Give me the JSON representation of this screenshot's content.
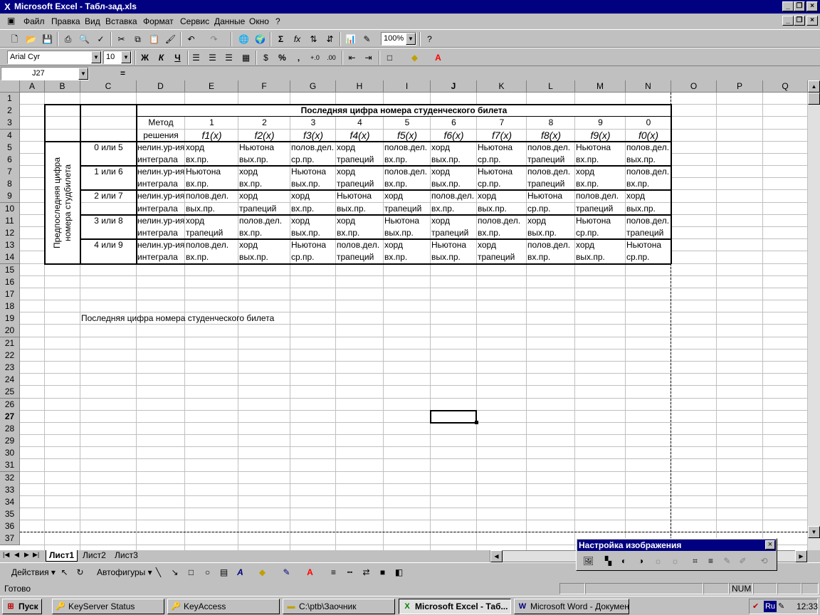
{
  "window": {
    "title": "Microsoft Excel - Табл-зад.xls",
    "app_icon": "excel-icon"
  },
  "menu": [
    "Файл",
    "Правка",
    "Вид",
    "Вставка",
    "Формат",
    "Сервис",
    "Данные",
    "Окно",
    "?"
  ],
  "toolbar": {
    "zoom": "100%",
    "font_name": "Arial Cyr",
    "font_size": "10",
    "bold": "Ж",
    "italic": "К",
    "underline": "Ч",
    "percent": "%",
    "comma": ",",
    "sum": "Σ",
    "fx": "fx"
  },
  "formula": {
    "name_box": "J27",
    "equals": "=",
    "content": ""
  },
  "columns": [
    "A",
    "B",
    "C",
    "D",
    "E",
    "F",
    "G",
    "H",
    "I",
    "J",
    "K",
    "L",
    "M",
    "N",
    "O",
    "P",
    "Q"
  ],
  "rows": [
    "1",
    "2",
    "3",
    "4",
    "5",
    "6",
    "7",
    "8",
    "9",
    "10",
    "11",
    "12",
    "13",
    "14",
    "15",
    "16",
    "17",
    "18",
    "19",
    "20",
    "21",
    "22",
    "23",
    "24",
    "25",
    "26",
    "27",
    "28",
    "29",
    "30",
    "31",
    "32",
    "33",
    "34",
    "35",
    "36",
    "37"
  ],
  "sheet": {
    "title_row": "Последняя цифра номера студенческого билета",
    "method_label_1": "Метод",
    "method_label_2": "решения",
    "side_label_1": "Предпоследняя цифра",
    "side_label_2": "номера студбилета",
    "digits": [
      "1",
      "2",
      "3",
      "4",
      "5",
      "6",
      "7",
      "8",
      "9",
      "0"
    ],
    "functions": [
      "f1(x)",
      "f2(x)",
      "f3(x)",
      "f4(x)",
      "f5(x)",
      "f6(x)",
      "f7(x)",
      "f8(x)",
      "f9(x)",
      "f0(x)"
    ],
    "groups": [
      {
        "label": "0 или 5",
        "type1": "нелин.ур-ия",
        "type2": "интеграла",
        "r1": [
          "хорд",
          "Ньютона",
          "полов.дел.",
          "хорд",
          "полов.дел.",
          "хорд",
          "Ньютона",
          "полов.дел.",
          "Ньютона",
          "полов.дел."
        ],
        "r2": [
          "вх.пр.",
          "вых.пр.",
          "ср.пр.",
          "трапеций",
          "вх.пр.",
          "вых.пр.",
          "ср.пр.",
          "трапеций",
          "вх.пр.",
          "вых.пр."
        ]
      },
      {
        "label": "1 или 6",
        "type1": "нелин.ур-ия",
        "type2": "интеграла",
        "r1": [
          "Ньютона",
          "хорд",
          "Ньютона",
          "хорд",
          "полов.дел.",
          "хорд",
          "Ньютона",
          "полов.дел.",
          "хорд",
          "полов.дел."
        ],
        "r2": [
          "вх.пр.",
          "вх.пр.",
          "вых.пр.",
          "трапеций",
          "вх.пр.",
          "вых.пр.",
          "ср.пр.",
          "трапеций",
          "вх.пр.",
          "вх.пр."
        ]
      },
      {
        "label": "2 или 7",
        "type1": "нелин.ур-ия",
        "type2": "интеграла",
        "r1": [
          "полов.дел.",
          "хорд",
          "хорд",
          "Ньютона",
          "хорд",
          "полов.дел.",
          "хорд",
          "Ньютона",
          "полов.дел.",
          "хорд"
        ],
        "r2": [
          "вых.пр.",
          "трапеций",
          "вх.пр.",
          "вых.пр.",
          "трапеций",
          "вх.пр.",
          "вых.пр.",
          "ср.пр.",
          "трапеций",
          "вых.пр."
        ]
      },
      {
        "label": "3 или 8",
        "type1": "нелин.ур-ия",
        "type2": "интеграла",
        "r1": [
          "хорд",
          "полов.дел.",
          "хорд",
          "хорд",
          "Ньютона",
          "хорд",
          "полов.дел.",
          "хорд",
          "Ньютона",
          "полов.дел."
        ],
        "r2": [
          "трапеций",
          "вх.пр.",
          "вых.пр.",
          "вх.пр.",
          "вых.пр.",
          "трапеций",
          "вх.пр.",
          "вых.пр.",
          "ср.пр.",
          "трапеций"
        ]
      },
      {
        "label": "4 или 9",
        "type1": "нелин.ур-ия",
        "type2": "интеграла",
        "r1": [
          "полов.дел.",
          "хорд",
          "Ньютона",
          "полов.дел.",
          "хорд",
          "Ньютона",
          "хорд",
          "полов.дел.",
          "хорд",
          "Ньютона"
        ],
        "r2": [
          "вх.пр.",
          "вых.пр.",
          "ср.пр.",
          "трапеций",
          "вх.пр.",
          "вых.пр.",
          "трапеций",
          "вх.пр.",
          "вых.пр.",
          "ср.пр."
        ]
      }
    ],
    "c19_text": "Последняя цифра номера студенческого билета",
    "selected_cell": "J27"
  },
  "sheet_tabs": [
    "Лист1",
    "Лист2",
    "Лист3"
  ],
  "active_sheet": "Лист1",
  "drawing": {
    "actions": "Действия",
    "autoshapes": "Автофигуры"
  },
  "palette": {
    "title": "Настройка изображения",
    "close": "×"
  },
  "status": {
    "ready": "Готово",
    "num": "NUM"
  },
  "taskbar": {
    "start": "Пуск",
    "items": [
      "KeyServer Status",
      "KeyAccess",
      "C:\\ptb\\Заочник",
      "Microsoft Excel - Таб...",
      "Microsoft Word - Докумен..."
    ],
    "lang": "Ru",
    "clock": "12:33"
  }
}
